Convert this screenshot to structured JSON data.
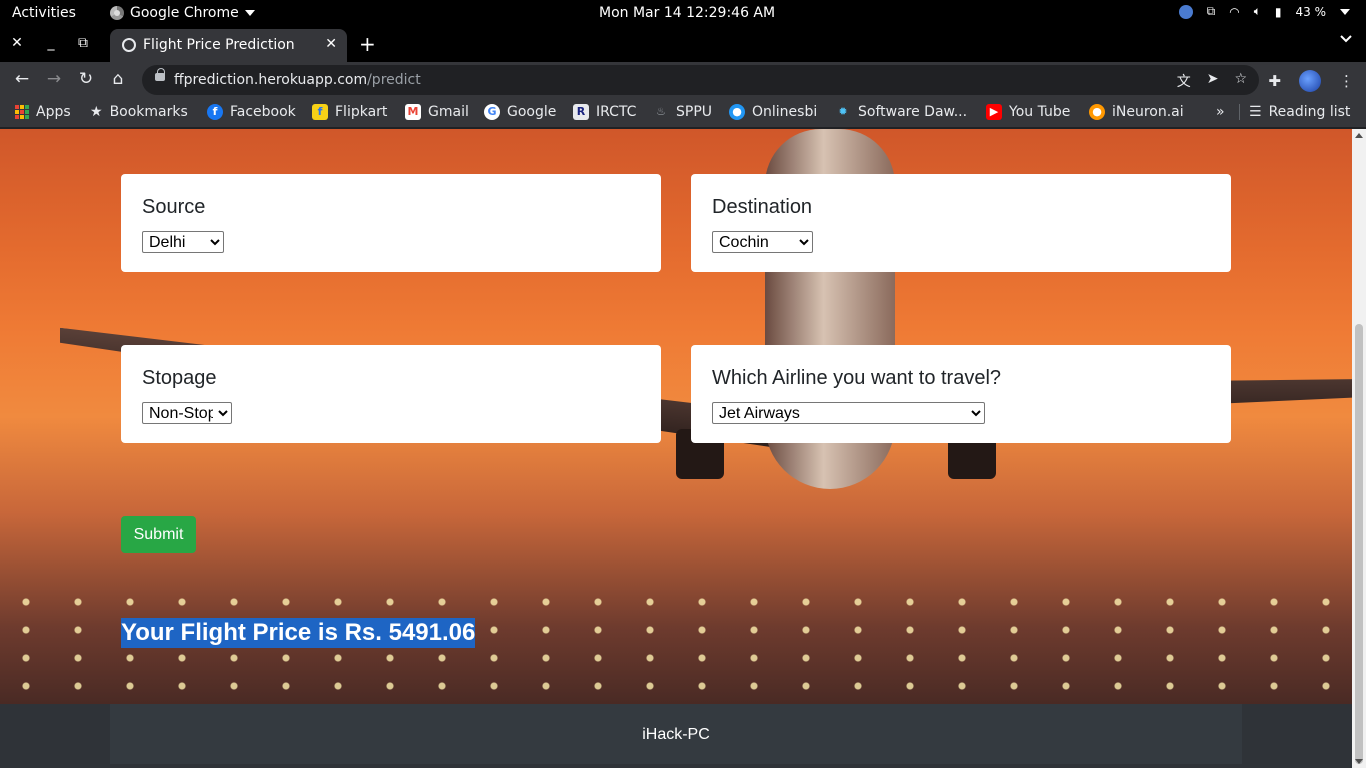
{
  "system_bar": {
    "activities": "Activities",
    "app_name": "Google Chrome",
    "clock": "Mon Mar 14  12:29:46 AM",
    "battery": "43 %"
  },
  "browser": {
    "tab_title": "Flight Price Prediction",
    "url_host": "ffprediction.herokuapp.com",
    "url_path": "/predict",
    "bookmarks": [
      "Apps",
      "Bookmarks",
      "Facebook",
      "Flipkart",
      "Gmail",
      "Google",
      "IRCTC",
      "SPPU",
      "Onlinesbi",
      "Software Daw...",
      "You Tube",
      "iNeuron.ai"
    ],
    "overflow": "»",
    "reading_list": "Reading list"
  },
  "form": {
    "source_label": "Source",
    "source_value": "Delhi",
    "destination_label": "Destination",
    "destination_value": "Cochin",
    "stopage_label": "Stopage",
    "stopage_value": "Non-Stop",
    "airline_label": "Which Airline you want to travel?",
    "airline_value": "Jet Airways",
    "submit_label": "Submit"
  },
  "result": {
    "text": "Your Flight Price is Rs. 5491.06"
  },
  "footer": {
    "text": "iHack-PC"
  },
  "colors": {
    "submit_green": "#28a745",
    "selection_blue": "#1e65c4",
    "footer_dark": "#343a40",
    "chrome_toolbar": "#35363a"
  }
}
